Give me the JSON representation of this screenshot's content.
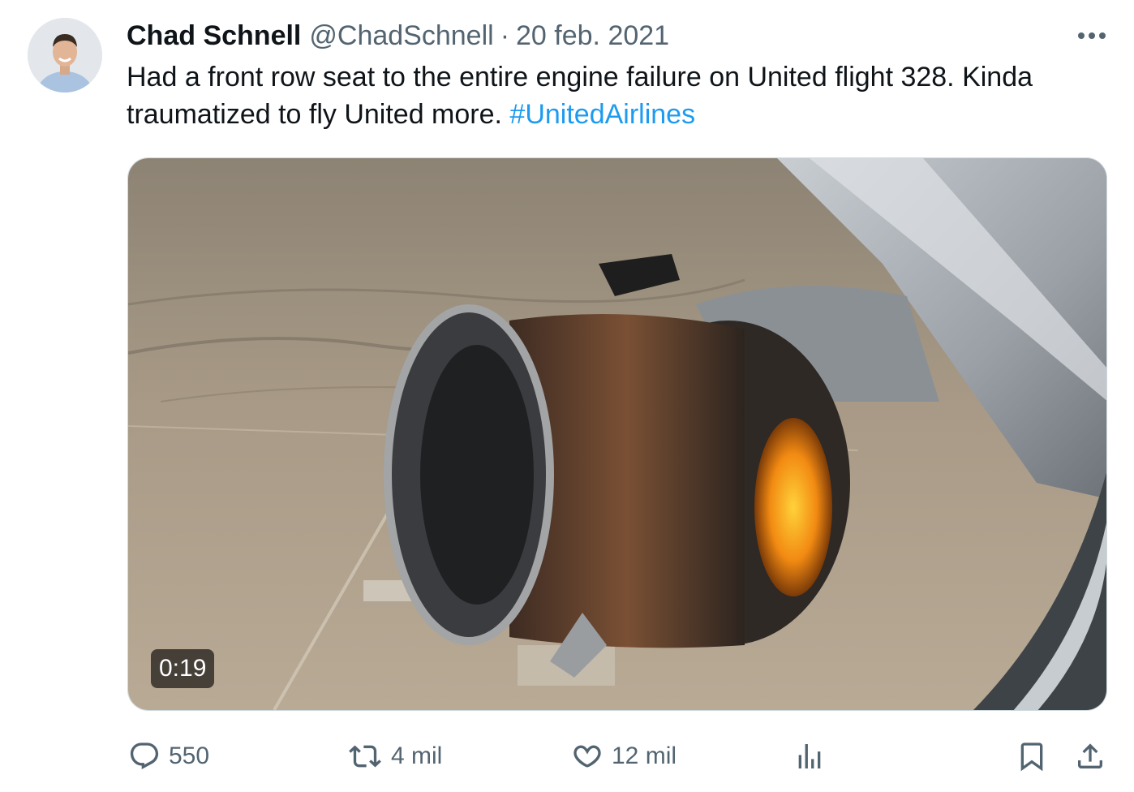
{
  "author": {
    "name": "Chad Schnell",
    "handle": "@ChadSchnell",
    "separator": "·",
    "date": "20 feb. 2021"
  },
  "tweet": {
    "text": "Had a front row seat to the entire engine failure on United flight 328. Kinda traumatized to fly United more.",
    "hashtag": "#UnitedAirlines"
  },
  "media": {
    "type": "video",
    "duration": "0:19"
  },
  "actions": {
    "replies": "550",
    "retweets": "4 mil",
    "likes": "12 mil"
  },
  "colors": {
    "link": "#1d9bf0",
    "secondary_text": "#536471",
    "text": "#0f1419"
  }
}
